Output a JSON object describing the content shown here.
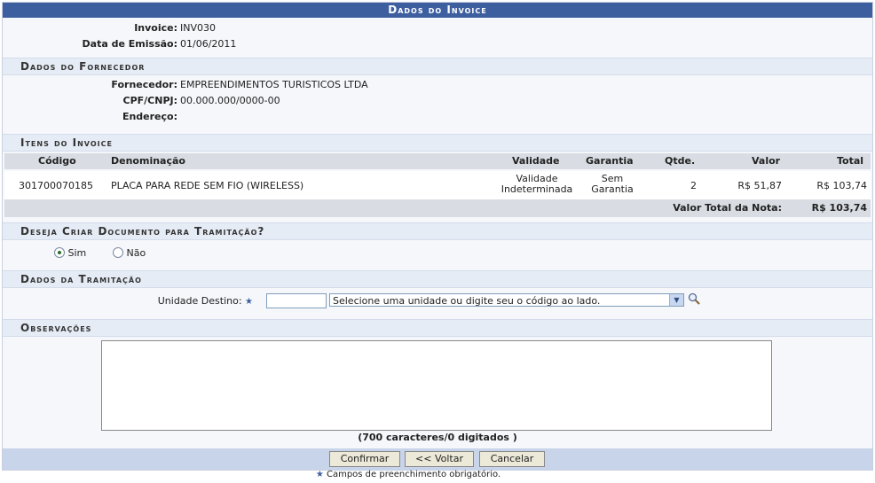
{
  "title": "Dados do Invoice",
  "invoice": {
    "label": "Invoice:",
    "value": "INV030"
  },
  "emissao": {
    "label": "Data de Emissão:",
    "value": "01/06/2011"
  },
  "fornecedor_section": "Dados do Fornecedor",
  "fornecedor": {
    "label": "Fornecedor:",
    "value": "EMPREENDIMENTOS TURISTICOS LTDA"
  },
  "cpf": {
    "label": "CPF/CNPJ:",
    "value": "00.000.000/0000-00"
  },
  "endereco": {
    "label": "Endereço:",
    "value": ""
  },
  "itens_section": "Itens do Invoice",
  "table": {
    "headers": {
      "codigo": "Código",
      "denominacao": "Denominação",
      "validade": "Validade",
      "garantia": "Garantia",
      "qtde": "Qtde.",
      "valor": "Valor",
      "total": "Total"
    },
    "rows": [
      {
        "codigo": "301700070185",
        "denominacao": "PLACA PARA REDE SEM FIO (WIRELESS)",
        "validade_1": "Validade",
        "validade_2": "Indeterminada",
        "garantia_1": "Sem",
        "garantia_2": "Garantia",
        "qtde": "2",
        "valor": "R$ 51,87",
        "total": "R$ 103,74"
      }
    ],
    "total_label": "Valor Total da Nota:",
    "total_value": "R$ 103,74"
  },
  "tramitacao_q_section": "Deseja Criar Documento para Tramitação?",
  "radio": {
    "sim": "Sim",
    "nao": "Não",
    "selected": "sim"
  },
  "tramitacao_section": "Dados da Tramitação",
  "unidade": {
    "label": "Unidade Destino:",
    "input_value": "",
    "select_value": "Selecione uma unidade ou digite seu o código ao lado."
  },
  "observacoes_section": "Observações",
  "char_counter": "(700 caracteres/0 digitados )",
  "buttons": {
    "confirmar": "Confirmar",
    "voltar": "<< Voltar",
    "cancelar": "Cancelar"
  },
  "required_note": "Campos de preenchimento obrigatório."
}
